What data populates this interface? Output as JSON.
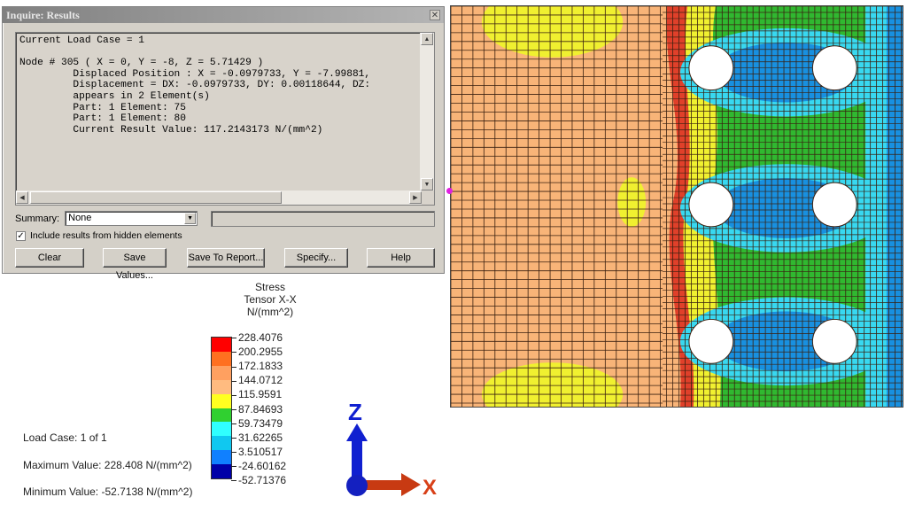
{
  "dialog": {
    "title": "Inquire: Results",
    "close_icon": "close-icon",
    "output_lines": [
      "Current Load Case = 1",
      "",
      "Node # 305 ( X = 0, Y = -8, Z = 5.71429 )",
      "         Displaced Position : X = -0.0979733, Y = -7.99881,",
      "         Displacement = DX: -0.0979733, DY: 0.00118644, DZ:",
      "         appears in 2 Element(s)",
      "         Part: 1 Element: 75",
      "         Part: 1 Element: 80",
      "         Current Result Value: 117.2143173 N/(mm^2)"
    ],
    "summary_label": "Summary:",
    "summary_value": "None",
    "include_hidden_label": "Include results from hidden elements",
    "include_hidden_checked": true,
    "buttons": {
      "clear": "Clear",
      "save_values": "Save Values...",
      "save_to_report": "Save To Report...",
      "specify": "Specify...",
      "help": "Help"
    }
  },
  "legend": {
    "title_line1": "Stress",
    "title_line2": "Tensor X-X",
    "title_line3": "N/(mm^2)",
    "ticks": [
      "228.4076",
      "200.2955",
      "172.1833",
      "144.0712",
      "115.9591",
      "87.84693",
      "59.73479",
      "31.62265",
      "3.510517",
      "-24.60162",
      "-52.71376"
    ],
    "colors": [
      "#ff0000",
      "#ff7020",
      "#ffa060",
      "#ffbb80",
      "#ffff20",
      "#30d030",
      "#30ffff",
      "#10c8f0",
      "#1080ff",
      "#0000a8"
    ]
  },
  "info": {
    "load_case": "Load Case:  1 of 1",
    "max_value": "Maximum Value: 228.408 N/(mm^2)",
    "min_value": "Minimum Value: -52.7138 N/(mm^2)"
  },
  "triad": {
    "z_label": "Z",
    "x_label": "X",
    "z_color": "#1020d0",
    "x_color": "#d03a10"
  },
  "model": {
    "colors": {
      "orange": "#f8b478",
      "yellow": "#f0f030",
      "red": "#e0402a",
      "green": "#30b830",
      "cyan": "#38d8f0",
      "blue": "#1890e0",
      "mesh_line": "#3a2010"
    }
  }
}
